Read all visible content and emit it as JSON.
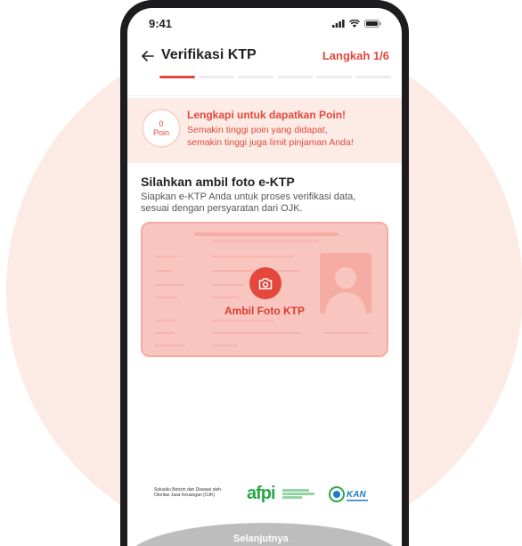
{
  "status_bar": {
    "time": "9:41"
  },
  "header": {
    "title": "Verifikasi KTP",
    "step": "Langkah 1/6",
    "total_steps": 6,
    "current_step": 1
  },
  "poin": {
    "value": "0",
    "unit": "Poin",
    "title": "Lengkapi untuk dapatkan Poin!",
    "desc_line1": "Semakin tinggi poin yang didapat,",
    "desc_line2": "semakin tinggi juga limit pinjaman Anda!"
  },
  "section": {
    "title": "Silahkan ambil foto e-KTP",
    "desc": "Siapkan e-KTP Anda untuk proses verifikasi data, sesuai dengan persyaratan dari OJK."
  },
  "ktp": {
    "label": "Ambil Foto KTP",
    "icon": "camera-icon"
  },
  "footer": {
    "ojk_text": "Solusiku Berizin dan Diawasi oleh Otoritas Jasa Keuangan (OJK)",
    "afpi_logo": "afpi",
    "kan_logo": "KAN"
  },
  "next_button": "Selanjutnya",
  "colors": {
    "accent": "#e4473c",
    "banner_bg": "#fdece6",
    "card_bg": "#f9c6bf"
  }
}
